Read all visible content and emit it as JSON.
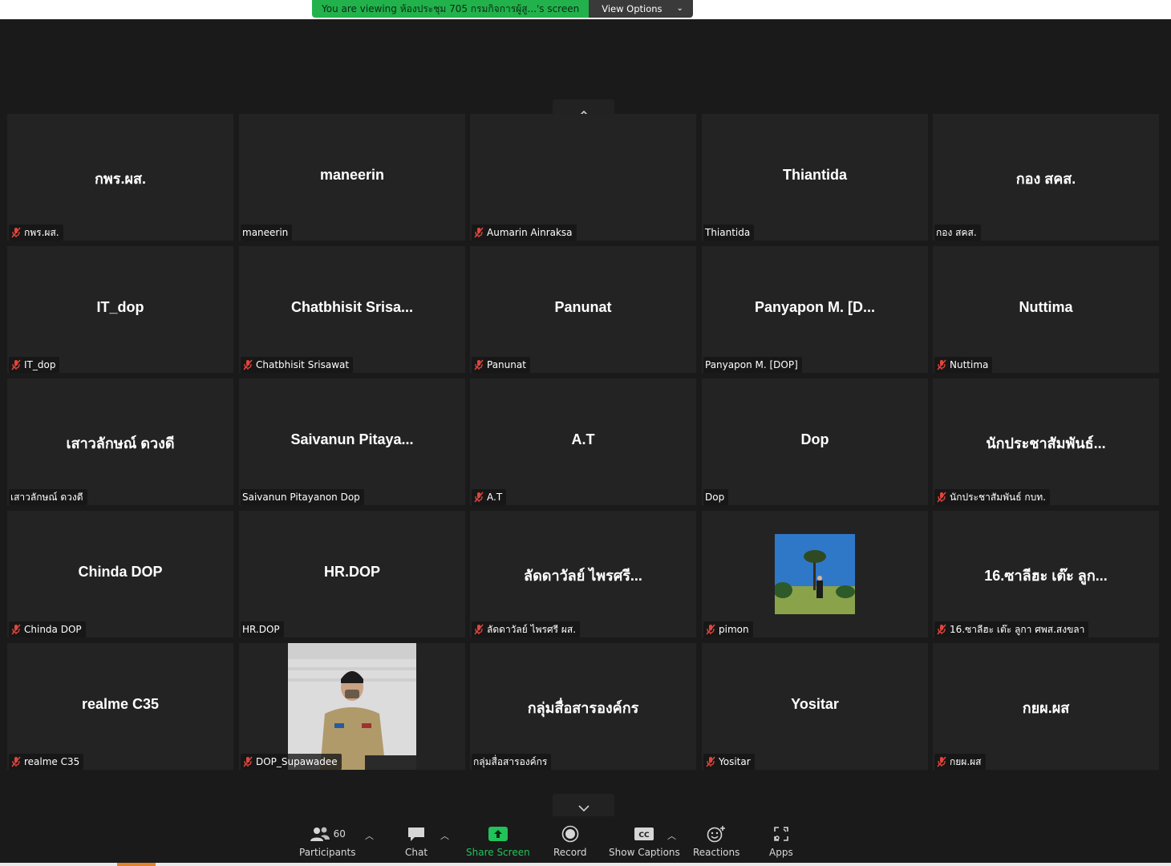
{
  "banner": {
    "viewing_text": "You are viewing ห้องประชุม 705 กรมกิจการผู้สู...'s screen",
    "view_options_label": "View Options"
  },
  "tiles": [
    {
      "big": "กพร.ผส.",
      "label": "กพร.ผส.",
      "muted": true
    },
    {
      "big": "maneerin",
      "label": "maneerin",
      "muted": false
    },
    {
      "big": "",
      "label": "Aumarin Ainraksa",
      "muted": true,
      "video": true
    },
    {
      "big": "Thiantida",
      "label": "Thiantida",
      "muted": false
    },
    {
      "big": "กอง สคส.",
      "label": "กอง สคส.",
      "muted": false
    },
    {
      "big": "IT_dop",
      "label": "IT_dop",
      "muted": true
    },
    {
      "big": "Chatbhisit  Srisa...",
      "label": "Chatbhisit Srisawat",
      "muted": true
    },
    {
      "big": "Panunat",
      "label": "Panunat",
      "muted": true
    },
    {
      "big": "Panyapon  M.  [D...",
      "label": "Panyapon M. [DOP]",
      "muted": false
    },
    {
      "big": "Nuttima",
      "label": "Nuttima",
      "muted": true
    },
    {
      "big": "เสาวลักษณ์ ดวงดี",
      "label": "เสาวลักษณ์ ดวงดี",
      "muted": false
    },
    {
      "big": "Saivanun  Pitaya...",
      "label": "Saivanun Pitayanon Dop",
      "muted": false
    },
    {
      "big": "A.T",
      "label": "A.T",
      "muted": true
    },
    {
      "big": "Dop",
      "label": "Dop",
      "muted": false
    },
    {
      "big": "นักประชาสัมพันธ์...",
      "label": "นักประชาสัมพันธ์ กบท.",
      "muted": true
    },
    {
      "big": "Chinda DOP",
      "label": "Chinda DOP",
      "muted": true
    },
    {
      "big": "HR.DOP",
      "label": "HR.DOP",
      "muted": false
    },
    {
      "big": "ลัดดาวัลย์ ไพรศรี...",
      "label": "ลัดดาวัลย์ ไพรศรี ผส.",
      "muted": true
    },
    {
      "big": "",
      "label": "pimon",
      "muted": true,
      "video": true
    },
    {
      "big": "16.ซาลีฮะ เต๊ะ ลูก...",
      "label": "16.ซาลีฮะ เต๊ะ ลูกา ศพส.สงขลา",
      "muted": true
    },
    {
      "big": "realme C35",
      "label": "realme C35",
      "muted": true
    },
    {
      "big": "",
      "label": "DOP_Supawadee",
      "muted": true,
      "video": true
    },
    {
      "big": "กลุ่มสื่อสารองค์กร",
      "label": "กลุ่มสื่อสารองค์กร",
      "muted": false
    },
    {
      "big": "Yositar",
      "label": "Yositar",
      "muted": true
    },
    {
      "big": "กยผ.ผส",
      "label": "กยผ.ผส",
      "muted": true
    }
  ],
  "toolbar": {
    "participants_count": "60",
    "participants_label": "Participants",
    "chat_label": "Chat",
    "share_label": "Share Screen",
    "record_label": "Record",
    "captions_label": "Show Captions",
    "reactions_label": "Reactions",
    "apps_label": "Apps"
  },
  "colors": {
    "banner_green": "#22b24c",
    "share_green": "#22c25a",
    "muted_red": "#e0463c",
    "tile_bg": "#232323"
  }
}
